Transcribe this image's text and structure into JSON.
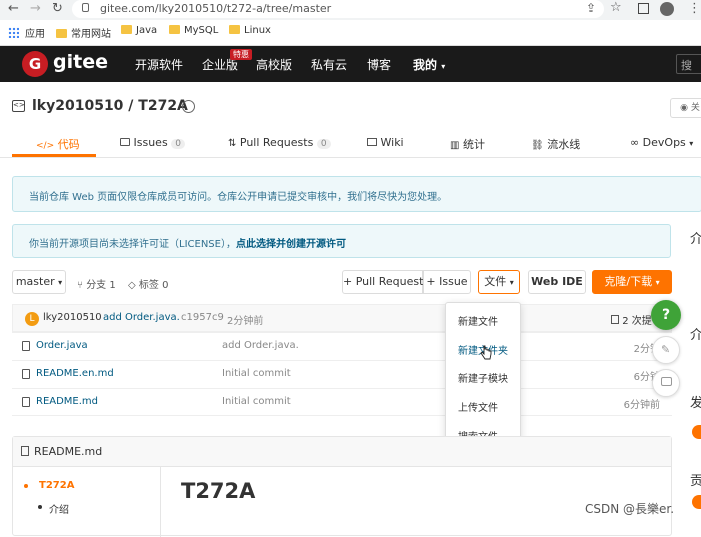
{
  "browser": {
    "url": "gitee.com/lky2010510/t272-a/tree/master",
    "bookmarks": [
      "应用",
      "常用网站",
      "Java",
      "MySQL",
      "Linux"
    ]
  },
  "header": {
    "logo": "gitee",
    "nav": [
      "开源软件",
      "企业版",
      "高校版",
      "私有云",
      "博客",
      "我的"
    ],
    "badge": "特惠",
    "search_placeholder": "搜"
  },
  "repo": {
    "title": "lky2010510 / T272A",
    "tabs": [
      {
        "label": "代码"
      },
      {
        "label": "Issues",
        "count": "0"
      },
      {
        "label": "Pull Requests",
        "count": "0"
      },
      {
        "label": "Wiki"
      },
      {
        "label": "统计"
      },
      {
        "label": "流水线"
      },
      {
        "label": "DevOps"
      }
    ]
  },
  "notices": {
    "visibility": "当前仓库 Web 页面仅限仓库成员可访问。仓库公开申请已提交审核中，我们将尽快为您处理。",
    "license_prefix": "你当前开源项目尚未选择许可证（LICENSE），",
    "license_link": "点此选择并创建开源许可"
  },
  "toolbar": {
    "branch": "master",
    "branches": "分支 1",
    "tags": "标签 0",
    "pull_request": "+ Pull Request",
    "issue": "+ Issue",
    "files": "文件",
    "web_ide": "Web IDE",
    "clone": "克隆/下载"
  },
  "commit": {
    "avatar": "L",
    "author": "lky2010510",
    "message": "add Order.java.",
    "hash": "c1957c9",
    "time": "2分钟前",
    "count": "2 次提"
  },
  "files": [
    {
      "name": "Order.java",
      "message": "add Order.java.",
      "time": "2分钟"
    },
    {
      "name": "README.en.md",
      "message": "Initial commit",
      "time": "6分钟"
    },
    {
      "name": "README.md",
      "message": "Initial commit",
      "time": "6分钟前"
    }
  ],
  "file_menu": [
    "新建文件",
    "新建文件夹",
    "新建子模块",
    "上传文件",
    "搜索文件"
  ],
  "readme": {
    "header": "README.md",
    "toc": [
      "T272A",
      "介绍"
    ],
    "title": "T272A"
  },
  "watermark": "CSDN @長樂er.",
  "floating": {
    "help": "?"
  },
  "sidebar_fragments": [
    "介",
    "介",
    "发",
    "贡"
  ],
  "colors": {
    "header_bg": "#1a1a1a",
    "accent": "#fe7300",
    "brand": "#c71d23",
    "help": "#3fa338"
  }
}
